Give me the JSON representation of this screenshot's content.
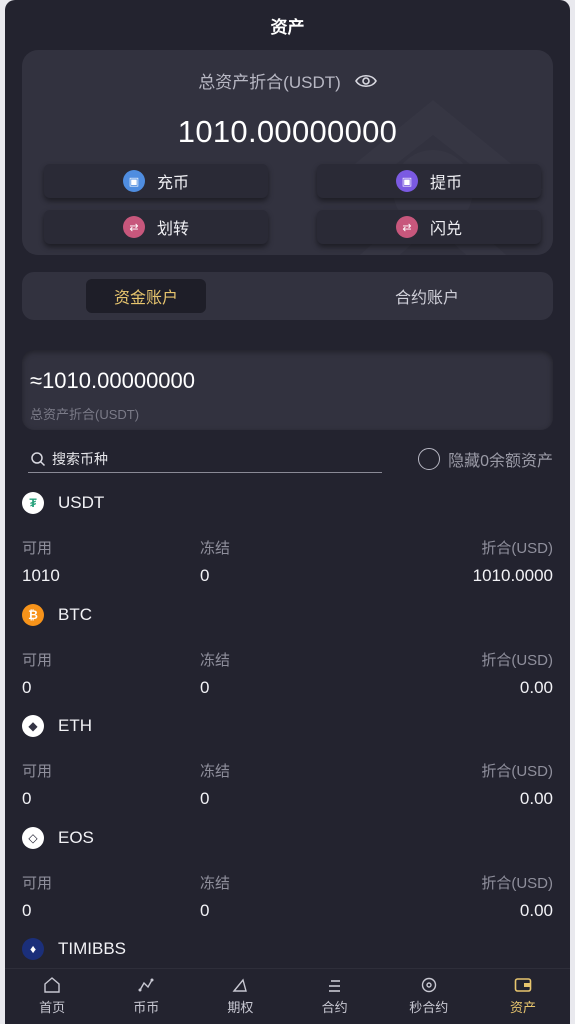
{
  "header": {
    "title": "资产"
  },
  "summary": {
    "label": "总资产折合(USDT)",
    "total": "1010.00000000",
    "actions": [
      {
        "label": "充币",
        "icon": "wallet-in-icon",
        "color": "#4f8de0"
      },
      {
        "label": "提币",
        "icon": "wallet-out-icon",
        "color": "#7b5ae2"
      },
      {
        "label": "划转",
        "icon": "transfer-icon",
        "color": "#c7577c"
      },
      {
        "label": "闪兑",
        "icon": "flash-swap-icon",
        "color": "#c7577c"
      }
    ]
  },
  "tabs": [
    {
      "label": "资金账户",
      "active": true
    },
    {
      "label": "合约账户",
      "active": false
    }
  ],
  "balance": {
    "amount": "≈1010.00000000",
    "label": "总资产折合(USDT)"
  },
  "search": {
    "placeholder": "搜索币种",
    "hide_zero_label": "隐藏0余额资产"
  },
  "columns": {
    "available": "可用",
    "frozen": "冻结",
    "converted": "折合(USD)"
  },
  "coins": [
    {
      "name": "USDT",
      "available": "1010",
      "frozen": "0",
      "converted": "1010.0000",
      "logo_color": "#ffffff",
      "logo_text": "₮",
      "logo_fg": "#26a17b"
    },
    {
      "name": "BTC",
      "available": "0",
      "frozen": "0",
      "converted": "0.00",
      "logo_color": "#f7931a",
      "logo_text": "₿",
      "logo_fg": "#ffffff"
    },
    {
      "name": "ETH",
      "available": "0",
      "frozen": "0",
      "converted": "0.00",
      "logo_color": "#ffffff",
      "logo_text": "◆",
      "logo_fg": "#333344"
    },
    {
      "name": "EOS",
      "available": "0",
      "frozen": "0",
      "converted": "0.00",
      "logo_color": "#ffffff",
      "logo_text": "◇",
      "logo_fg": "#222233"
    },
    {
      "name": "TIMIBBS",
      "available": "",
      "frozen": "",
      "converted": "",
      "logo_color": "#1b2f7a",
      "logo_text": "🔥",
      "logo_fg": "#ffffff"
    }
  ],
  "nav": [
    {
      "label": "首页",
      "icon": "home-icon",
      "active": false
    },
    {
      "label": "币币",
      "icon": "spot-icon",
      "active": false
    },
    {
      "label": "期权",
      "icon": "options-icon",
      "active": false
    },
    {
      "label": "合约",
      "icon": "contract-icon",
      "active": false
    },
    {
      "label": "秒合约",
      "icon": "second-contract-icon",
      "active": false
    },
    {
      "label": "资产",
      "icon": "assets-icon",
      "active": true
    }
  ],
  "colors": {
    "accent": "#e7c56e",
    "background": "#23232f",
    "card": "#32323f"
  }
}
